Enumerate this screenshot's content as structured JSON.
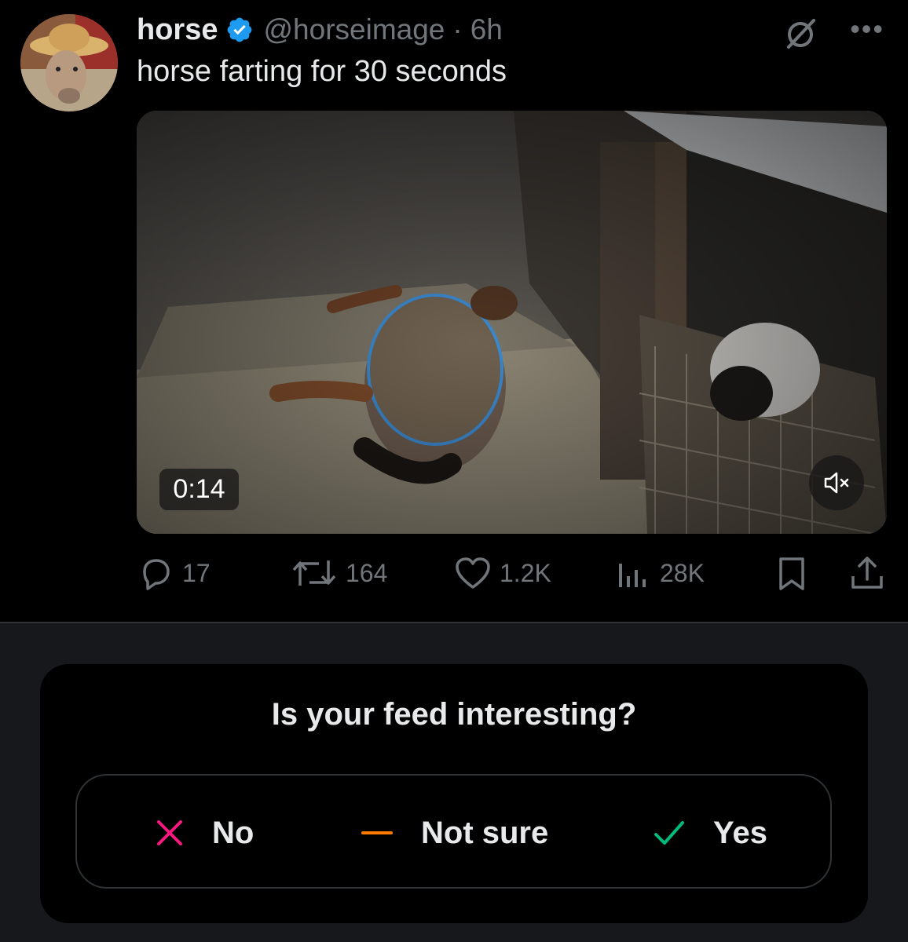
{
  "tweet": {
    "display_name": "horse",
    "handle": "@horseimage",
    "separator": "·",
    "time": "6h",
    "text": "horse farting for 30 seconds",
    "media": {
      "duration": "0:14"
    },
    "actions": {
      "replies": "17",
      "retweets": "164",
      "likes": "1.2K",
      "views": "28K"
    },
    "icons": {
      "verified": "verified-badge-icon",
      "grok": "grok-icon",
      "more": "more-icon",
      "reply": "reply-icon",
      "retweet": "retweet-icon",
      "like": "heart-icon",
      "views": "views-icon",
      "bookmark": "bookmark-icon",
      "share": "share-icon",
      "mute": "muted-speaker-icon"
    },
    "colors": {
      "verified": "#1d9bf0",
      "secondary_text": "#71767b"
    }
  },
  "feed_prompt": {
    "question": "Is your feed interesting?",
    "options": [
      {
        "label": "No",
        "icon": "x-icon",
        "color": "#f91880"
      },
      {
        "label": "Not sure",
        "icon": "dash-icon",
        "color": "#ff7a00"
      },
      {
        "label": "Yes",
        "icon": "check-icon",
        "color": "#00ba7c"
      }
    ]
  }
}
